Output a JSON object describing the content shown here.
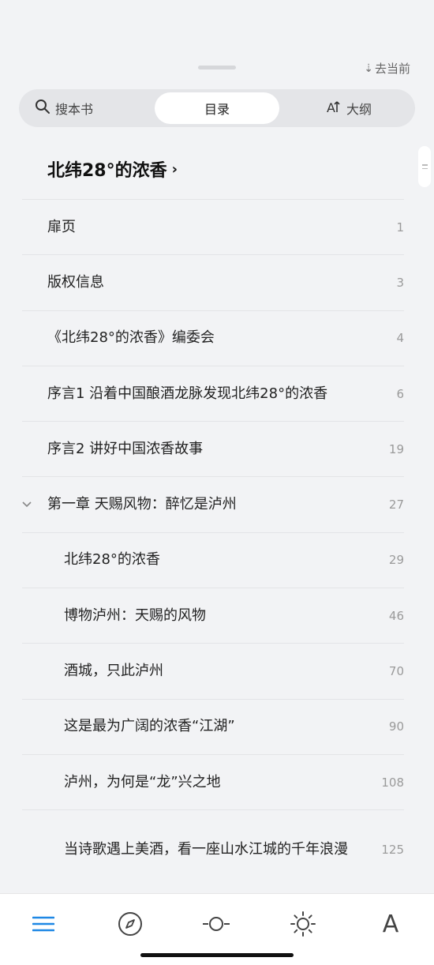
{
  "header": {
    "goto_current": "去当前",
    "tabs": {
      "search": "搜本书",
      "toc": "目录",
      "outline": "大纲"
    }
  },
  "book": {
    "title": "北纬28°的浓香",
    "chevron": "›"
  },
  "toc": [
    {
      "label": "扉页",
      "page": "1"
    },
    {
      "label": "版权信息",
      "page": "3"
    },
    {
      "label": "《北纬28°的浓香》编委会",
      "page": "4"
    },
    {
      "label": "序言1 沿着中国酿酒龙脉发现北纬28°的浓香",
      "page": "6"
    },
    {
      "label": "序言2 讲好中国浓香故事",
      "page": "19"
    },
    {
      "label": "第一章 天赐风物：醉忆是泸州",
      "page": "27"
    },
    {
      "label": "北纬28°的浓香",
      "page": "29"
    },
    {
      "label": "博物泸州：天赐的风物",
      "page": "46"
    },
    {
      "label": "酒城，只此泸州",
      "page": "70"
    },
    {
      "label": "这是最为广阔的浓香“江湖”",
      "page": "90"
    },
    {
      "label": "泸州，为何是“龙”兴之地",
      "page": "108"
    },
    {
      "label": "当诗歌遇上美酒，看一座山水江城的千年浪漫",
      "page": "125"
    }
  ],
  "bottom_bar": {
    "icons": [
      "menu-icon",
      "compass-icon",
      "progress-icon",
      "brightness-icon",
      "font-icon"
    ],
    "font_glyph": "A"
  },
  "colors": {
    "accent": "#1e88e5",
    "background": "#f2f3f5"
  }
}
